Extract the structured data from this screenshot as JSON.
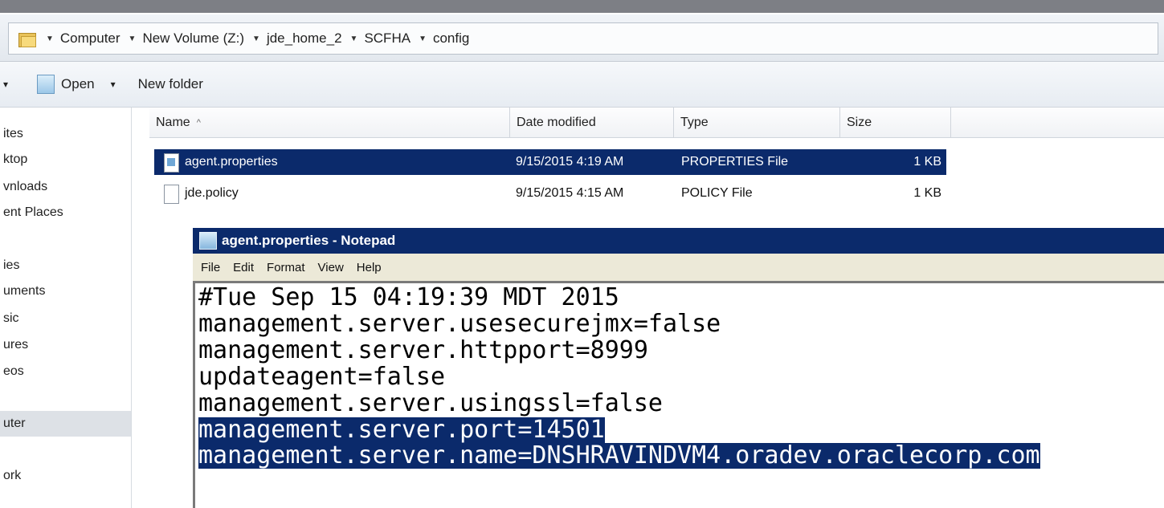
{
  "address_bar": {
    "crumbs": [
      "Computer",
      "New Volume (Z:)",
      "jde_home_2",
      "SCFHA",
      "config"
    ]
  },
  "toolbar": {
    "organize_fragment": "▾",
    "open_label": "Open",
    "open_arrow": "▾",
    "new_folder_label": "New folder"
  },
  "sidebar": {
    "items": [
      "ites",
      "ktop",
      "vnloads",
      "ent Places",
      "ies",
      "uments",
      "sic",
      "ures",
      "eos",
      "uter",
      "ork"
    ],
    "selected_item": "uter"
  },
  "file_list": {
    "columns": {
      "name": "Name",
      "sort_indicator": "^",
      "date": "Date modified",
      "type": "Type",
      "size": "Size"
    },
    "rows": [
      {
        "name": "agent.properties",
        "date": "9/15/2015 4:19 AM",
        "type": "PROPERTIES File",
        "size": "1 KB",
        "selected": true
      },
      {
        "name": "jde.policy",
        "date": "9/15/2015 4:15 AM",
        "type": "POLICY File",
        "size": "1 KB",
        "selected": false
      }
    ]
  },
  "notepad": {
    "title": "agent.properties - Notepad",
    "menu": [
      "File",
      "Edit",
      "Format",
      "View",
      "Help"
    ],
    "lines": [
      {
        "text": "#Tue Sep 15 04:19:39 MDT 2015",
        "selected": false
      },
      {
        "text": "management.server.usesecurejmx=false",
        "selected": false
      },
      {
        "text": "management.server.httpport=8999",
        "selected": false
      },
      {
        "text": "updateagent=false",
        "selected": false
      },
      {
        "text": "management.server.usingssl=false",
        "selected": false
      },
      {
        "text": "management.server.port=14501",
        "selected": true
      },
      {
        "text": "management.server.name=DNSHRAVINDVM4.oradev.oraclecorp.com",
        "selected": true
      }
    ]
  },
  "colors": {
    "selection": "#0b2a6b",
    "title_bar": "#0b2a6b",
    "menu_bar": "#ece9d8"
  }
}
